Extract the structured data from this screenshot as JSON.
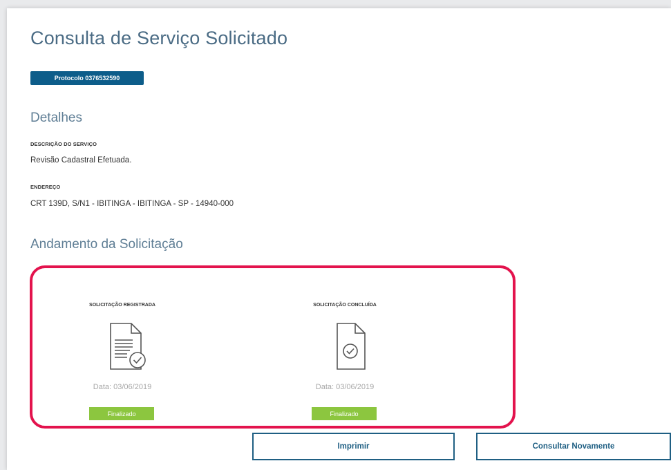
{
  "page": {
    "title": "Consulta de Serviço Solicitado",
    "protocol_label": "Protocolo 0376532590"
  },
  "details": {
    "section_title": "Detalhes",
    "description_label": "DESCRIÇÃO DO SERVIÇO",
    "description_value": "Revisão Cadastral Efetuada.",
    "address_label": "ENDEREÇO",
    "address_value": "CRT 139D, S/N1 - IBITINGA - IBITINGA - SP - 14940-000"
  },
  "progress": {
    "section_title": "Andamento da Solicitação",
    "steps": [
      {
        "title": "SOLICITAÇÃO REGISTRADA",
        "icon": "document-lines-check-icon",
        "date": "Data: 03/06/2019",
        "status": "Finalizado"
      },
      {
        "title": "SOLICITAÇÃO CONCLUÍDA",
        "icon": "document-check-icon",
        "date": "Data: 03/06/2019",
        "status": "Finalizado"
      }
    ]
  },
  "actions": {
    "print_label": "Imprimir",
    "query_again_label": "Consultar Novamente"
  },
  "colors": {
    "title": "#4a6b84",
    "protocol_bg": "#0d5d8a",
    "highlight_border": "#e3134d",
    "status_green": "#8cc63f",
    "button_border": "#1f5f83"
  }
}
